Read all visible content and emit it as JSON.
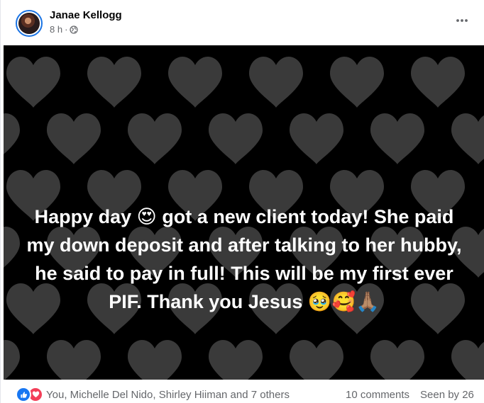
{
  "post": {
    "author": "Janae Kellogg",
    "time": "8 h",
    "separator": "·",
    "privacy_icon": "globe-icon",
    "more_icon": "more-options-icon",
    "text": "Happy day 😍 got a new client today! She paid my down deposit and after talking to her hubby, he said to pay in full! This will be my first ever PIF. Thank you Jesus 🥹🥰🙏🏽",
    "background": {
      "color": "#000000",
      "pattern": "hearts",
      "pattern_color": "#3a3a3a"
    }
  },
  "footer": {
    "reactions": [
      "like-icon",
      "love-icon"
    ],
    "reactors": "You, Michelle Del Nido, Shirley Hiiman and 7 others",
    "comments": "10 comments",
    "seen_by": "Seen by 26"
  },
  "colors": {
    "like": "#1877f2",
    "love": "#f33e58",
    "secondary_text": "#65676b"
  }
}
